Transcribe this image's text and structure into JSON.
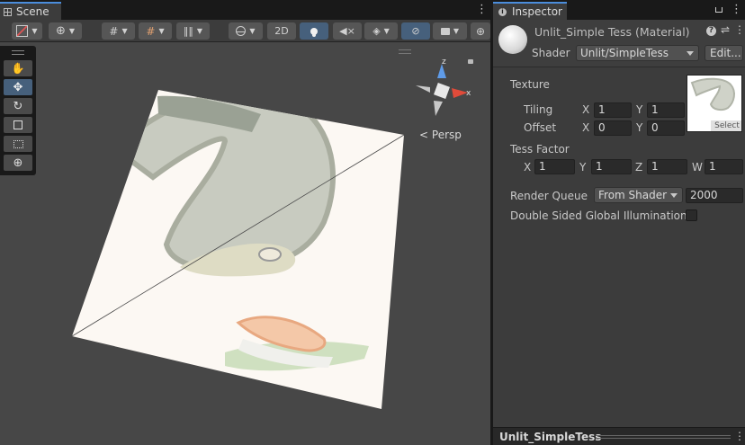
{
  "scene": {
    "tab_label": "Scene",
    "toolbar": {
      "mode_2d_label": "2D"
    },
    "gizmo": {
      "projection_label": "Persp",
      "axis_z": "z",
      "axis_x": "x"
    }
  },
  "inspector": {
    "tab_label": "Inspector",
    "material_title": "Unlit_Simple Tess (Material)",
    "shader_label": "Shader",
    "shader_value": "Unlit/SimpleTess",
    "edit_label": "Edit...",
    "texture": {
      "label": "Texture",
      "tiling_label": "Tiling",
      "offset_label": "Offset",
      "tiling_x": "1",
      "tiling_y": "1",
      "offset_x": "0",
      "offset_y": "0",
      "x_label": "X",
      "y_label": "Y",
      "select_label": "Select"
    },
    "tess": {
      "label": "Tess Factor",
      "x_label": "X",
      "y_label": "Y",
      "z_label": "Z",
      "w_label": "W",
      "x": "1",
      "y": "1",
      "z": "1",
      "w": "1"
    },
    "render_queue": {
      "label": "Render Queue",
      "dropdown_value": "From Shader",
      "value": "2000"
    },
    "double_sided_gi": {
      "label": "Double Sided Global Illumination",
      "checked": false
    }
  },
  "preview": {
    "title": "Unlit_SimpleTess"
  },
  "colors": {
    "accent": "#4b8ddc",
    "active_button": "#46607c",
    "panel": "#3c3c3c",
    "viewport": "#474747"
  }
}
